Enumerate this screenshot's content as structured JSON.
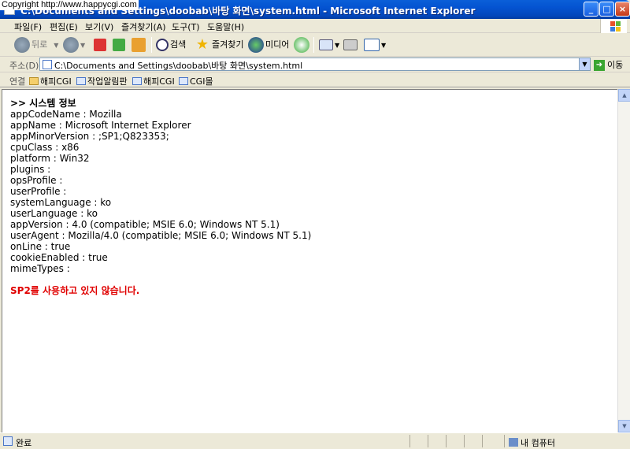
{
  "watermark": "Copyright  http://www.happycgi.com",
  "window": {
    "title": "C:\\Documents and Settings\\doobab\\바탕 화면\\system.html - Microsoft Internet Explorer"
  },
  "menu": [
    "파일(F)",
    "편집(E)",
    "보기(V)",
    "즐겨찾기(A)",
    "도구(T)",
    "도움말(H)"
  ],
  "toolbar": {
    "back": "뒤로",
    "search": "검색",
    "favorites": "즐겨찾기",
    "media": "미디어"
  },
  "address": {
    "label": "주소(D)",
    "value": "C:\\Documents and Settings\\doobab\\바탕 화면\\system.html",
    "go": "이동"
  },
  "links": {
    "label": "연결",
    "items": [
      "해피CGI",
      "작업알림판",
      "해피CGI",
      "CGI몰"
    ]
  },
  "content": {
    "heading": ">> 시스템 정보",
    "lines": [
      "appCodeName : Mozilla",
      "appName : Microsoft Internet Explorer",
      "appMinorVersion : ;SP1;Q823353;",
      "cpuClass : x86",
      "platform : Win32",
      "plugins :",
      "opsProfile :",
      "userProfile :",
      "systemLanguage : ko",
      "userLanguage : ko",
      "appVersion : 4.0 (compatible; MSIE 6.0; Windows NT 5.1)",
      "userAgent : Mozilla/4.0 (compatible; MSIE 6.0; Windows NT 5.1)",
      "onLine : true",
      "cookieEnabled : true",
      "mimeTypes :"
    ],
    "warning": "SP2를 사용하고 있지 않습니다."
  },
  "status": {
    "text": "완료",
    "zone": "내 컴퓨터"
  },
  "colors": {
    "title_blue": "#0453d1",
    "warning_red": "#e00000"
  }
}
